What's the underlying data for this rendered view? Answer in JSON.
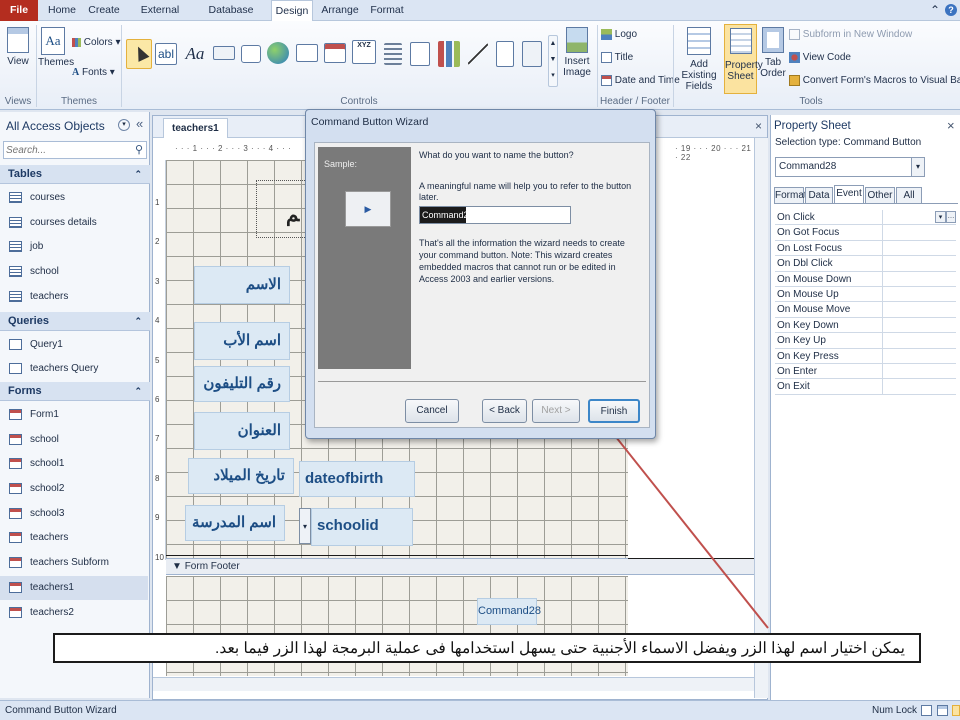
{
  "tabs": {
    "file": "File",
    "home": "Home",
    "create": "Create",
    "external": "External Data",
    "dbtools": "Database Tools",
    "design": "Design",
    "arrange": "Arrange",
    "format": "Format"
  },
  "ribbon": {
    "views": {
      "view": "View",
      "group": "Views"
    },
    "themes": {
      "themes": "Themes",
      "colors": "Colors",
      "fonts": "Fonts",
      "group": "Themes"
    },
    "controls": {
      "group": "Controls",
      "insert_image": "Insert Image",
      "text_box_glyph": "abl",
      "label_glyph": "Aa",
      "chart_text": "XYZ"
    },
    "header_footer": {
      "logo": "Logo",
      "title": "Title",
      "date_time": "Date and Time",
      "group": "Header / Footer"
    },
    "tools": {
      "add_fields": "Add Existing Fields",
      "property_sheet": "Property Sheet",
      "tab_order": "Tab Order",
      "subform": "Subform in New Window",
      "view_code": "View Code",
      "convert": "Convert Form's Macros to Visual Basic",
      "group": "Tools"
    }
  },
  "nav": {
    "title": "All Access Objects",
    "search_placeholder": "Search...",
    "tables_header": "Tables",
    "tables": [
      "courses",
      "courses details",
      "job",
      "school",
      "teachers"
    ],
    "queries_header": "Queries",
    "queries": [
      "Query1",
      "teachers Query"
    ],
    "forms_header": "Forms",
    "forms": [
      "Form1",
      "school",
      "school1",
      "school2",
      "school3",
      "teachers",
      "teachers Subform",
      "teachers1",
      "teachers2"
    ]
  },
  "document": {
    "tab": "teachers1",
    "ruler_left": "· · · 1 · · · 2 · · · 3 · · · 4 · · ·",
    "ruler_right": "· 19 · · · 20 · · · 21 · · · 22",
    "vruler": [
      "1",
      "2",
      "3",
      "4",
      "5",
      "6",
      "7",
      "8",
      "9",
      "10"
    ],
    "form_footer": "Form Footer",
    "labels": [
      "الاسم",
      "اسم الأب",
      "رقم التليفون",
      "العنوان",
      "تاريخ الميلاد",
      "اسم المدرسة"
    ],
    "fields": {
      "dob": "dateofbirth",
      "school": "schoolid"
    },
    "footer_button": "Command28"
  },
  "wizard": {
    "title": "Command Button Wizard",
    "sample": "Sample:",
    "question": "What do you want to name the button?",
    "hint": "A meaningful name will help you to refer to the button later.",
    "name_value": "Command28",
    "info": "That's all the information the wizard needs to create your command button. Note: This wizard creates embedded macros that cannot run or be edited in Access 2003 and earlier versions.",
    "cancel": "Cancel",
    "back": "< Back",
    "next": "Next >",
    "finish": "Finish"
  },
  "property_sheet": {
    "title": "Property Sheet",
    "selection_label": "Selection type:  Command Button",
    "selected": "Command28",
    "tabs": [
      "Format",
      "Data",
      "Event",
      "Other",
      "All"
    ],
    "active_tab": "Event",
    "events": [
      "On Click",
      "On Got Focus",
      "On Lost Focus",
      "On Dbl Click",
      "On Mouse Down",
      "On Mouse Up",
      "On Mouse Move",
      "On Key Down",
      "On Key Up",
      "On Key Press",
      "On Enter",
      "On Exit"
    ]
  },
  "caption": "يمكن اختيار اسم لهذا الزر ويفضل الاسماء الأجنبية حتى يسهل استخدامها فى عملية البرمجة لهذا الزر فيما بعد.",
  "status": {
    "left": "Command Button Wizard",
    "numlock": "Num Lock"
  },
  "colors": {
    "file_tab": "#b42d1f",
    "accent": "#1d4e85",
    "arrow": "#c0504d"
  }
}
